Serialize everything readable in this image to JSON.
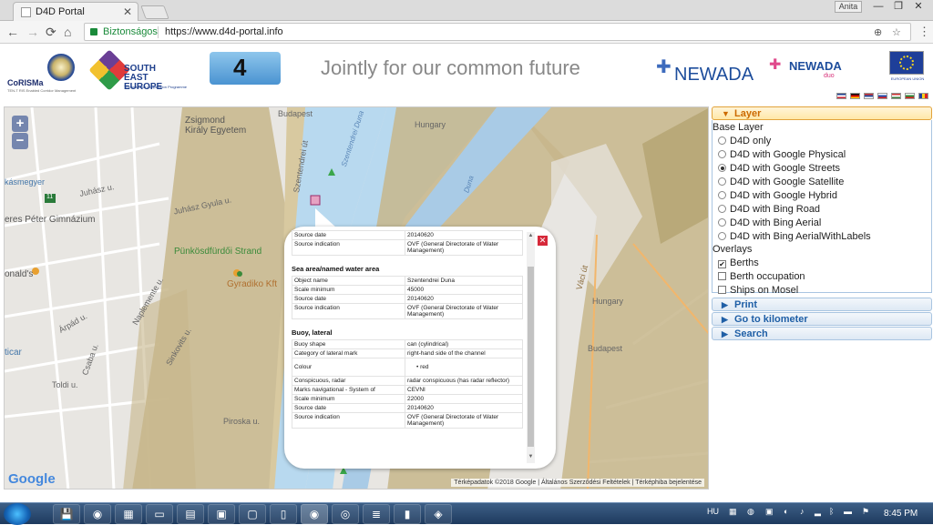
{
  "browser": {
    "tab_title": "D4D Portal",
    "tab_close": "✕",
    "user": "Anita",
    "min": "—",
    "restore": "❐",
    "close": "✕"
  },
  "address": {
    "back": "←",
    "forward": "→",
    "reload": "⟳",
    "home": "⌂",
    "secure_label": "Biztonságos",
    "url": "https://www.d4d-portal.info",
    "translate_icon": "⊕",
    "star_icon": "☆",
    "menu_icon": "⋮"
  },
  "header": {
    "coris": "CoRISMa",
    "coris_sub": "TEN-T RIS Enabled Corridor Management",
    "see": "SOUTH EAST EUROPE",
    "see_sub": "Transnational Cooperation Programme",
    "d4": "4",
    "slogan": "Jointly for our common future",
    "newada": "NEWADA",
    "newada_duo": "NEWADA",
    "newada_duo_sub": "duo",
    "eu_sub": "EUROPEAN UNION"
  },
  "map": {
    "zoom_in": "+",
    "zoom_out": "−",
    "labels": {
      "zsigmond": "Zsigmond",
      "kiraly": "Király Egyetem",
      "kasmegyer": "kásmegyer",
      "jerres": "eres Péter Gimnázium",
      "punkosd": "Pünkösdfürdői Strand",
      "gyradiko": "Gyradiko Kft",
      "donalds": "onald's",
      "ticar": "ticar",
      "duna": "Duna",
      "budapest_n": "Budapest",
      "hungary_n": "Hungary",
      "hungary_e": "Hungary",
      "budapest_e": "Budapest",
      "vaci_ut": "Váci út",
      "szentendrei": "Szentendrei Duna",
      "juhasz1": "Juhász u.",
      "juhasz2": "Juhász Gyula u.",
      "toldi": "Toldi u.",
      "arpad": "Árpád u.",
      "napfeny": "Naplemente u.",
      "csaba": "Csaba u.",
      "sinkovits": "Sinkovits u.",
      "piroska": "Piroska u.",
      "szabadsag": "Szentendrei út",
      "ut11": "11"
    },
    "google": "Google",
    "attribution": "Térképadatok ©2018 Google  |  Általános Szerződési Feltételek  |  Térképhiba bejelentése"
  },
  "popup": {
    "close": "✕",
    "up": "▲",
    "down": "▼",
    "top_rows": [
      {
        "k": "Source date",
        "v": "20140620"
      },
      {
        "k": "Source indication",
        "v": "OVF (General Directorate of Water Management)"
      }
    ],
    "sea_title": "Sea area/named water area",
    "sea_rows": [
      {
        "k": "Object name",
        "v": "Szentendrei Duna"
      },
      {
        "k": "Scale minimum",
        "v": "45000"
      },
      {
        "k": "Source date",
        "v": "20140620"
      },
      {
        "k": "Source indication",
        "v": "OVF (General Directorate of Water Management)"
      }
    ],
    "buoy_title": "Buoy, lateral",
    "buoy_rows": [
      {
        "k": "Buoy shape",
        "v": "can (cylindrical)"
      },
      {
        "k": "Category of lateral mark",
        "v": "right-hand side of the channel"
      },
      {
        "k": "Colour",
        "v": "red"
      },
      {
        "k": "Conspicuous, radar",
        "v": "radar conspicuous (has radar reflector)"
      },
      {
        "k": "Marks navigational - System of",
        "v": "CEVNI"
      },
      {
        "k": "Scale minimum",
        "v": "22000"
      },
      {
        "k": "Source date",
        "v": "20140620"
      },
      {
        "k": "Source indication",
        "v": "OVF (General Directorate of Water Management)"
      }
    ]
  },
  "side": {
    "layer": "Layer",
    "base_layer": "Base Layer",
    "base_options": [
      "D4D only",
      "D4D with Google Physical",
      "D4D with Google Streets",
      "D4D with Google Satellite",
      "D4D with Google Hybrid",
      "D4D with Bing Road",
      "D4D with Bing Aerial",
      "D4D with Bing AerialWithLabels"
    ],
    "selected_base": "D4D with Google Streets",
    "overlays": "Overlays",
    "overlay_options": [
      "Berths",
      "Berth occupation",
      "Ships on Mosel"
    ],
    "print": "Print",
    "go_km": "Go to kilometer",
    "search": "Search"
  },
  "taskbar": {
    "lang": "HU",
    "time": "8:45 PM"
  }
}
